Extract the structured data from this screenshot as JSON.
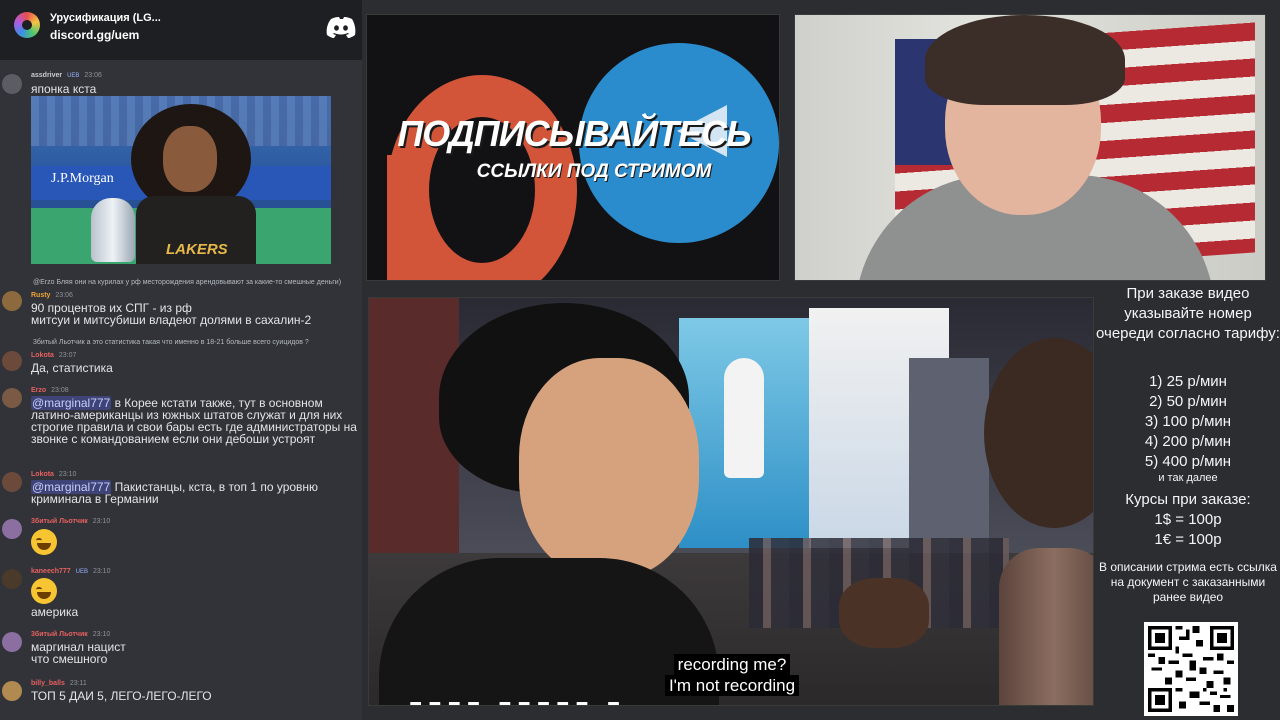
{
  "server": {
    "name": "Урусификация (LG...",
    "invite": "discord.gg/uem"
  },
  "chat": {
    "messages": [
      {
        "user": "assdriver",
        "badge": "UEB",
        "time": "23:06",
        "text": "японка кста",
        "color": "#c9cdd2"
      },
      {
        "reply": "@Erzo Бляя они на курилах у рф месторождения арендовывают за какие-то смешные деньги)",
        "user": "Rusty",
        "time": "23:06",
        "text": "90 процентов их СПГ - из рф\nмитсуи и митсубиши владеют долями в сахалин-2",
        "color": "#f0a338"
      },
      {
        "reply": "3битый Льотчик а это статистика такая что именно в 18-21 больше всего суицидов ?",
        "user": "Lokota",
        "time": "23:07",
        "text": "Да, статистика",
        "color": "#e86060"
      },
      {
        "user": "Erzo",
        "time": "23:08",
        "mention": "@marginal777",
        "text": " в Корее кстати также, тут в основном латино-американцы из южных штатов служат и для них строгие правила и свои бары есть где администраторы на звонке с командованием если они дебоши устроят",
        "color": "#e86060"
      },
      {
        "user": "Lokota",
        "time": "23:10",
        "mention": "@marginal777",
        "text": " Пакистанцы, кста, в топ 1 по уровню криминала в Германии",
        "color": "#e86060"
      },
      {
        "user": "3битый Льотчик",
        "time": "23:10",
        "text": "",
        "color": "#e86060"
      },
      {
        "user": "kaneech777",
        "badge": "UEB",
        "time": "23:10",
        "text": "америка",
        "color": "#e86060"
      },
      {
        "user": "3битый Льотчик",
        "time": "23:10",
        "text": "маргинал нацист\nчто смешного",
        "color": "#e86060"
      },
      {
        "user": "billy_balls",
        "time": "23:11",
        "text": "ТОП 5 ДАИ 5, ЛЕГО-ЛЕГО-ЛЕГО",
        "color": "#e86060"
      }
    ],
    "image_text": {
      "brand": "J.P.Morgan",
      "shirt": "LAKERS"
    }
  },
  "promo": {
    "title": "ПОДПИСЫВАЙТЕСЬ",
    "subtitle": "ССЫЛКИ ПОД СТРИМОМ"
  },
  "video": {
    "subtitle_line1": "recording me?",
    "subtitle_line2": "I'm not recording"
  },
  "info": {
    "order_text": "При заказе видео указывайте номер очереди согласно тарифу:",
    "tariffs": [
      "1) 25 р/мин",
      "2) 50 р/мин",
      "3) 100 р/мин",
      "4) 200 р/мин",
      "5) 400 р/мин"
    ],
    "tariffs_etc": "и так далее",
    "rates_title": "Курсы при заказе:",
    "rates": [
      "1$ = 100р",
      "1€ = 100р"
    ],
    "description": "В описании стрима есть ссылка на документ с заказанными ранее видео"
  },
  "icons": {
    "discord": "discord-icon",
    "qr": "qr-code-icon"
  },
  "colors": {
    "discord_bg": "#313338",
    "header_bg": "#1e1f22",
    "telegram": "#2a8ccd",
    "patreon": "#d2553a"
  }
}
